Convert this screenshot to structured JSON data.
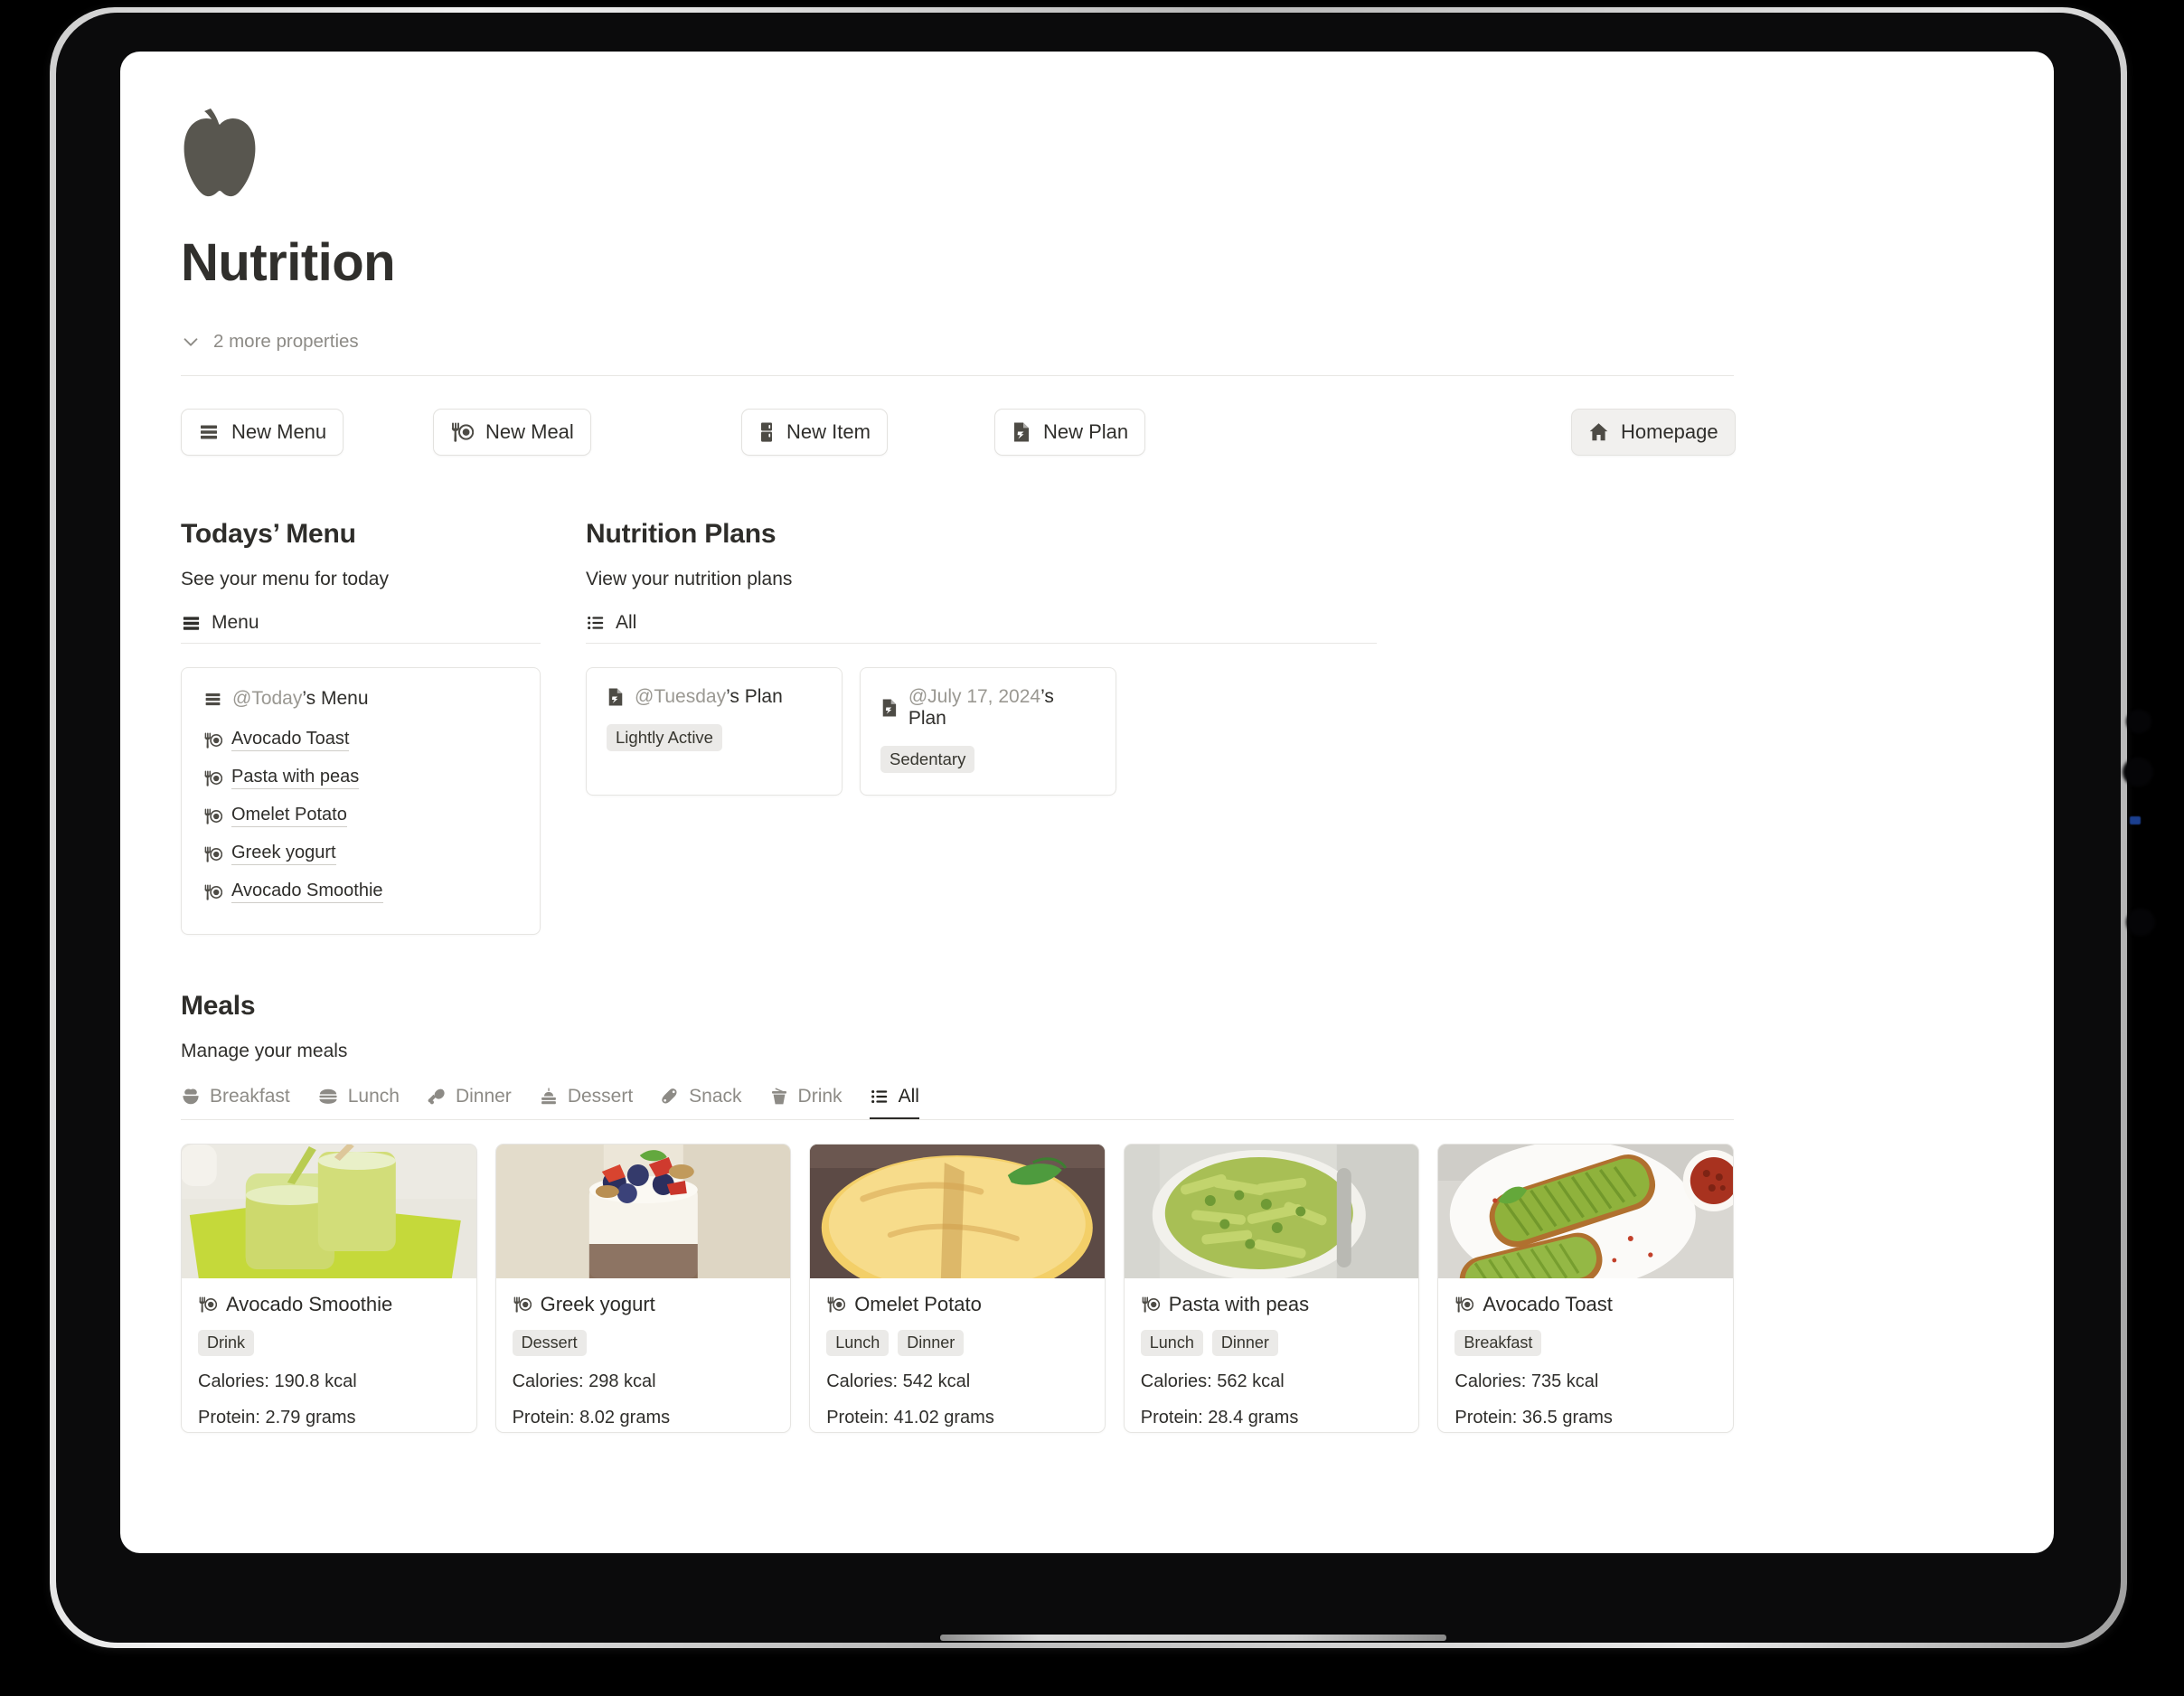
{
  "header": {
    "icon": "apple-icon",
    "title": "Nutrition",
    "more_properties": "2 more properties",
    "chevron_icon": "chevron-down-icon"
  },
  "toolbar": {
    "buttons": [
      {
        "label": "New Menu",
        "icon": "menu-stack-icon",
        "filled": false
      },
      {
        "label": "New Meal",
        "icon": "fork-plate-icon",
        "filled": false
      },
      {
        "label": "New Item",
        "icon": "fridge-icon",
        "filled": false
      },
      {
        "label": "New Plan",
        "icon": "document-plan-icon",
        "filled": false
      },
      {
        "label": "Homepage",
        "icon": "home-icon",
        "filled": true
      }
    ]
  },
  "todays_menu": {
    "title": "Todays’ Menu",
    "subtitle": "See your menu for today",
    "tab_label": "Menu",
    "tab_icon": "menu-stack-icon",
    "card": {
      "title_prefix": "@Today",
      "title_suffix": "’s Menu",
      "icon": "menu-stack-icon",
      "items": [
        {
          "label": "Avocado Toast",
          "icon": "fork-plate-icon"
        },
        {
          "label": "Pasta with peas",
          "icon": "fork-plate-icon"
        },
        {
          "label": "Omelet Potato",
          "icon": "fork-plate-icon"
        },
        {
          "label": "Greek yogurt",
          "icon": "fork-plate-icon"
        },
        {
          "label": "Avocado Smoothie",
          "icon": "fork-plate-icon"
        }
      ]
    }
  },
  "nutrition_plans": {
    "title": "Nutrition Plans",
    "subtitle": "View your nutrition plans",
    "tab_label": "All",
    "tab_icon": "list-icon",
    "cards": [
      {
        "title_prefix": "@Tuesday",
        "title_suffix": "’s Plan",
        "icon": "document-plan-icon",
        "tag": "Lightly Active"
      },
      {
        "title_prefix": "@July 17, 2024",
        "title_suffix": "’s Plan",
        "icon": "document-plan-icon",
        "tag": "Sedentary"
      }
    ]
  },
  "meals": {
    "title": "Meals",
    "subtitle": "Manage your meals",
    "tabs": [
      {
        "label": "Breakfast",
        "icon": "bowl-icon",
        "active": false
      },
      {
        "label": "Lunch",
        "icon": "burger-icon",
        "active": false
      },
      {
        "label": "Dinner",
        "icon": "drumstick-icon",
        "active": false
      },
      {
        "label": "Dessert",
        "icon": "cake-icon",
        "active": false
      },
      {
        "label": "Snack",
        "icon": "peanut-icon",
        "active": false
      },
      {
        "label": "Drink",
        "icon": "cup-straw-icon",
        "active": false
      },
      {
        "label": "All",
        "icon": "list-icon",
        "active": true
      }
    ],
    "cards": [
      {
        "name": "Avocado Smoothie",
        "icon": "fork-plate-icon",
        "tags": [
          "Drink"
        ],
        "calories": "Calories: 190.8 kcal",
        "protein": "Protein: 2.79 grams",
        "photo": "avocado-smoothie-photo"
      },
      {
        "name": "Greek yogurt",
        "icon": "fork-plate-icon",
        "tags": [
          "Dessert"
        ],
        "calories": "Calories: 298 kcal",
        "protein": "Protein: 8.02 grams",
        "photo": "greek-yogurt-photo"
      },
      {
        "name": "Omelet Potato",
        "icon": "fork-plate-icon",
        "tags": [
          "Lunch",
          "Dinner"
        ],
        "calories": "Calories: 542 kcal",
        "protein": "Protein: 41.02 grams",
        "photo": "omelet-potato-photo"
      },
      {
        "name": "Pasta with peas",
        "icon": "fork-plate-icon",
        "tags": [
          "Lunch",
          "Dinner"
        ],
        "calories": "Calories: 562 kcal",
        "protein": "Protein: 28.4 grams",
        "photo": "pasta-with-peas-photo"
      },
      {
        "name": "Avocado Toast",
        "icon": "fork-plate-icon",
        "tags": [
          "Breakfast"
        ],
        "calories": "Calories: 735 kcal",
        "protein": "Protein: 36.5 grams",
        "photo": "avocado-toast-photo"
      }
    ]
  },
  "colors": {
    "text_primary": "#2f2e2b",
    "text_muted": "#8d8b86",
    "card_border": "#e6e5e2",
    "tag_bg": "#ebeae8",
    "page_bg": "#ffffff"
  }
}
